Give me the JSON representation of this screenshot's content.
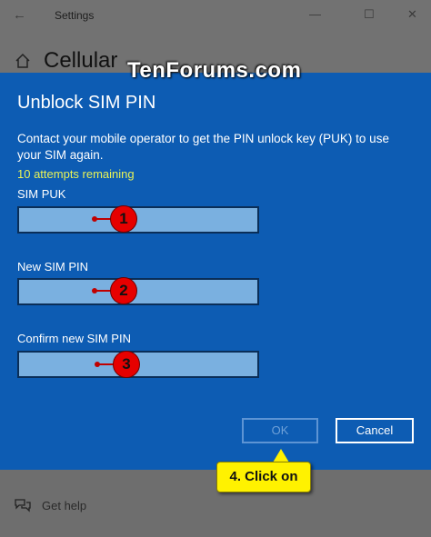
{
  "window": {
    "title": "Settings",
    "page_title": "Cellular",
    "back_icon": "back-arrow-icon",
    "controls": [
      "minimize-icon",
      "maximize-icon",
      "close-icon"
    ]
  },
  "watermark": "TenForums.com",
  "dialog": {
    "title": "Unblock SIM PIN",
    "description": "Contact your mobile operator to get the PIN unlock key (PUK) to use your SIM again.",
    "attempts": "10 attempts remaining",
    "fields": [
      {
        "label": "SIM PUK",
        "value": "",
        "marker": "1"
      },
      {
        "label": "New SIM PIN",
        "value": "",
        "marker": "2"
      },
      {
        "label": "Confirm new SIM PIN",
        "value": "",
        "marker": "3"
      }
    ],
    "ok_label": "OK",
    "cancel_label": "Cancel"
  },
  "callout": "4. Click on",
  "help": {
    "label": "Get help",
    "icon": "chat-bubbles-icon"
  },
  "colors": {
    "dialog_bg": "#0d5cb3",
    "attempts_text": "#e8f256",
    "marker": "#e60000",
    "callout_bg": "#fff200"
  }
}
